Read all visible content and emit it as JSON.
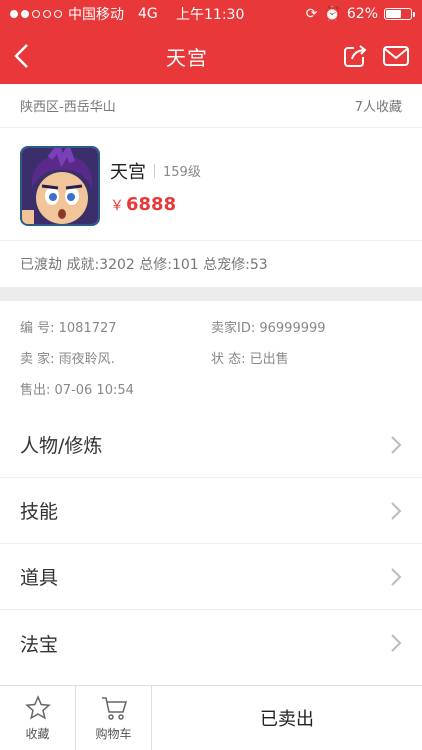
{
  "status": {
    "carrier": "中国移动",
    "network": "4G",
    "time": "上午11:30",
    "battery": "62%",
    "battery_level": 0.62
  },
  "nav": {
    "title": "天宫",
    "back_icon": "chevron-left-icon",
    "share_icon": "share-icon",
    "mail_icon": "mail-icon"
  },
  "region": {
    "server": "陕西区-西岳华山",
    "favorites": "7人收藏"
  },
  "character": {
    "name": "天宫",
    "level": "159级",
    "currency": "￥",
    "price": "6888"
  },
  "stats": "已渡劫 成就:3202 总修:101 总宠修:53",
  "details": {
    "id": "编 号: 1081727",
    "seller_id": "卖家ID: 96999999",
    "seller": "卖 家: 雨夜聆风.",
    "status": "状 态: 已出售",
    "sold_time": "售出: 07-06 10:54"
  },
  "menu": [
    {
      "label": "人物/修炼"
    },
    {
      "label": "技能"
    },
    {
      "label": "道具"
    },
    {
      "label": "法宝"
    }
  ],
  "bottom": {
    "favorite": "收藏",
    "cart": "购物车",
    "sold_label": "已卖出"
  },
  "colors": {
    "accent": "#e8383a"
  }
}
